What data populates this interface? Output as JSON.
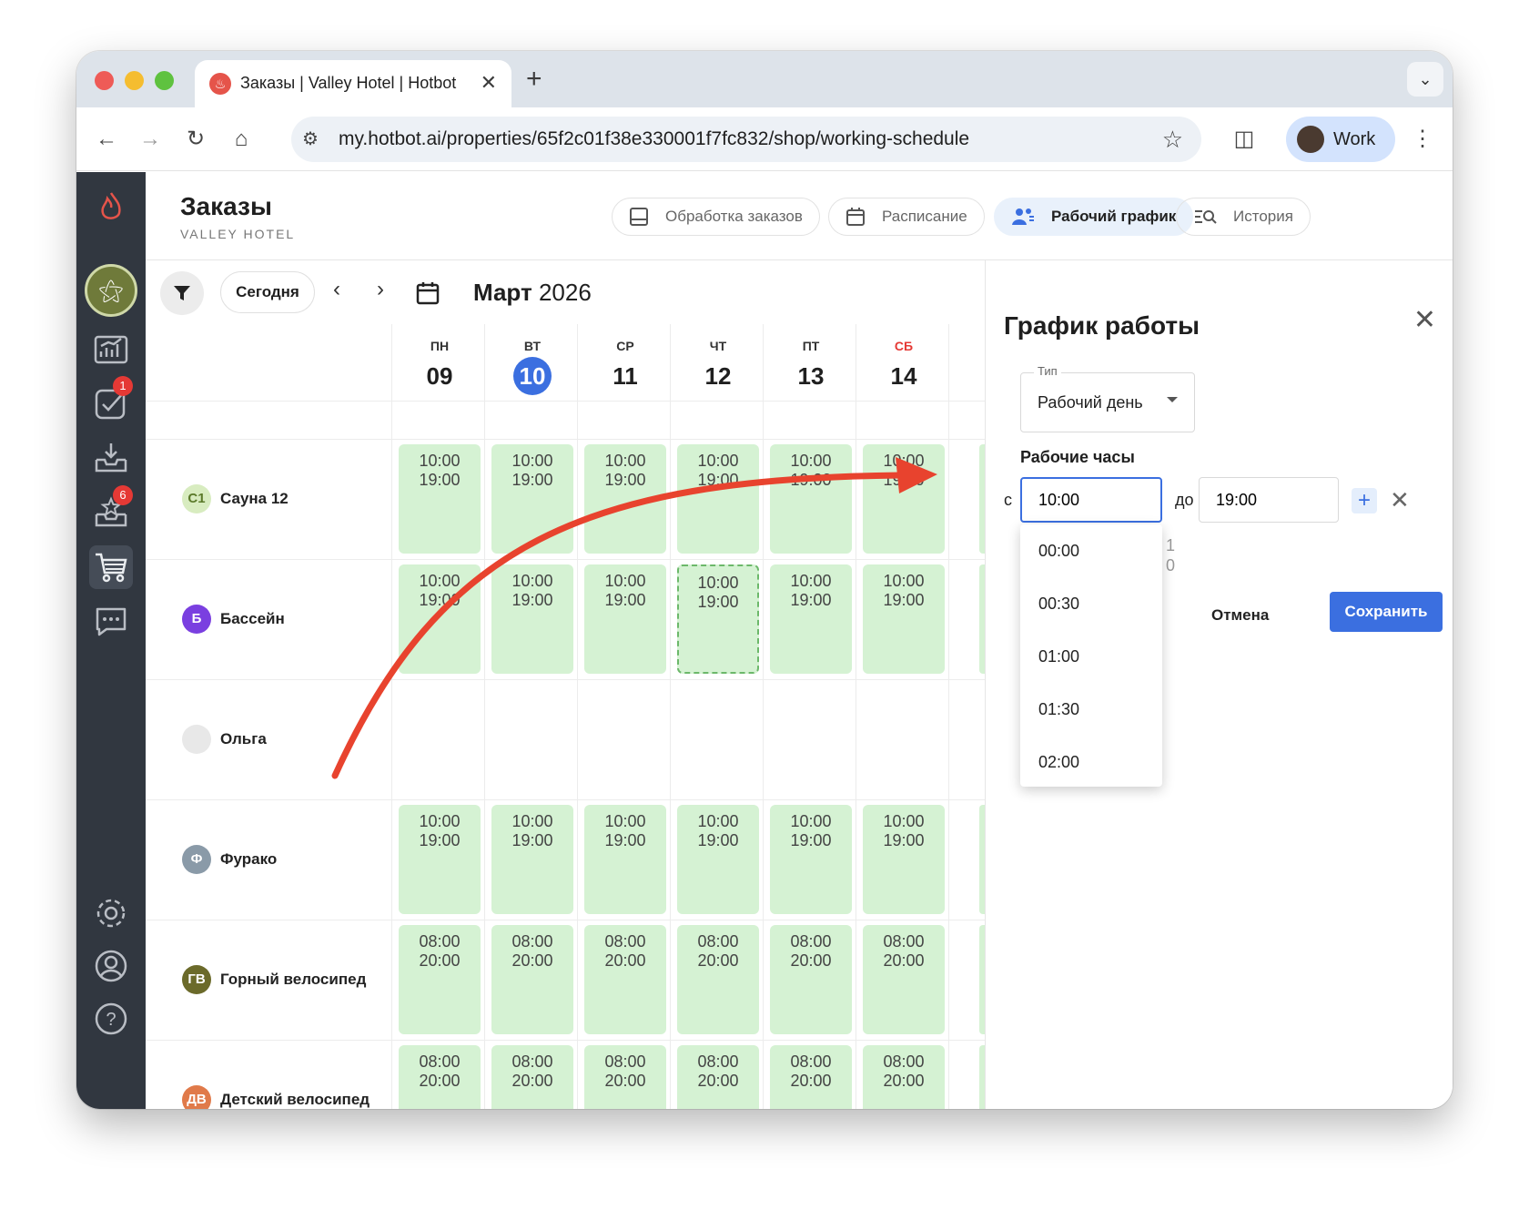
{
  "browser": {
    "tab_title": "Заказы | Valley Hotel | Hotbot",
    "url": "my.hotbot.ai/properties/65f2c01f38e330001f7fc832/shop/working-schedule",
    "profile_name": "Work"
  },
  "sidebar": {
    "badges": {
      "tasks": "1",
      "reviews": "6"
    }
  },
  "header": {
    "title": "Заказы",
    "subtitle": "VALLEY HOTEL",
    "tabs": [
      {
        "label": "Обработка заказов",
        "icon": "inbox-icon"
      },
      {
        "label": "Расписание",
        "icon": "calendar-icon"
      },
      {
        "label": "Рабочий график",
        "icon": "staff-icon",
        "active": true
      },
      {
        "label": "История",
        "icon": "history-search-icon"
      }
    ]
  },
  "calendar": {
    "today_label": "Сегодня",
    "month": "Март",
    "year": "2026",
    "days": [
      {
        "dow": "ПН",
        "num": "09"
      },
      {
        "dow": "ВТ",
        "num": "10",
        "today": true
      },
      {
        "dow": "СР",
        "num": "11"
      },
      {
        "dow": "ЧТ",
        "num": "12"
      },
      {
        "dow": "ПТ",
        "num": "13"
      },
      {
        "dow": "СБ",
        "num": "14",
        "weekend": true
      }
    ],
    "resources": [
      {
        "initials": "С1",
        "name": "Сауна 12",
        "color": "#d8ecc0",
        "text_color": "#5b7a2a",
        "slots": [
          [
            "10:00",
            "19:00"
          ],
          [
            "10:00",
            "19:00"
          ],
          [
            "10:00",
            "19:00"
          ],
          [
            "10:00",
            "19:00"
          ],
          [
            "10:00",
            "19:00"
          ],
          [
            "10:00",
            "19:00"
          ]
        ]
      },
      {
        "initials": "Б",
        "name": "Бассейн",
        "color": "#7a3fe0",
        "slots": [
          [
            "10:00",
            "19:00"
          ],
          [
            "10:00",
            "19:00"
          ],
          [
            "10:00",
            "19:00"
          ],
          [
            "10:00",
            "19:00"
          ],
          [
            "10:00",
            "19:00"
          ],
          [
            "10:00",
            "19:00"
          ]
        ]
      },
      {
        "initials": "",
        "name": "Ольга",
        "color": "#e8e8e8",
        "slots": []
      },
      {
        "initials": "Ф",
        "name": "Фурако",
        "color": "#8a9aa8",
        "slots": [
          [
            "10:00",
            "19:00"
          ],
          [
            "10:00",
            "19:00"
          ],
          [
            "10:00",
            "19:00"
          ],
          [
            "10:00",
            "19:00"
          ],
          [
            "10:00",
            "19:00"
          ],
          [
            "10:00",
            "19:00"
          ]
        ]
      },
      {
        "initials": "ГВ",
        "name": "Горный велосипед",
        "color": "#6b6a2a",
        "slots": [
          [
            "08:00",
            "20:00"
          ],
          [
            "08:00",
            "20:00"
          ],
          [
            "08:00",
            "20:00"
          ],
          [
            "08:00",
            "20:00"
          ],
          [
            "08:00",
            "20:00"
          ],
          [
            "08:00",
            "20:00"
          ]
        ]
      },
      {
        "initials": "ДВ",
        "name": "Детский велосипед",
        "color": "#e07a4a",
        "slots": [
          [
            "08:00",
            "20:00"
          ],
          [
            "08:00",
            "20:00"
          ],
          [
            "08:00",
            "20:00"
          ],
          [
            "08:00",
            "20:00"
          ],
          [
            "08:00",
            "20:00"
          ],
          [
            "08:00",
            "20:00"
          ]
        ]
      }
    ]
  },
  "panel": {
    "title": "График работы",
    "type_label": "Тип",
    "type_value": "Рабочий день",
    "hours_label": "Рабочие часы",
    "from_label": "с",
    "from_value": "10:00",
    "to_label": "до",
    "to_value": "19:00",
    "hidden_text": [
      "1",
      "0"
    ],
    "options": [
      "00:00",
      "00:30",
      "01:00",
      "01:30",
      "02:00"
    ],
    "cancel_label": "Отмена",
    "save_label": "Сохранить"
  },
  "colors": {
    "accent": "#3b6fe0",
    "slot_bg": "#d5f2d3",
    "sidebar_bg": "#313740",
    "annotation_arrow": "#e8432e",
    "weekend": "#e53935"
  }
}
